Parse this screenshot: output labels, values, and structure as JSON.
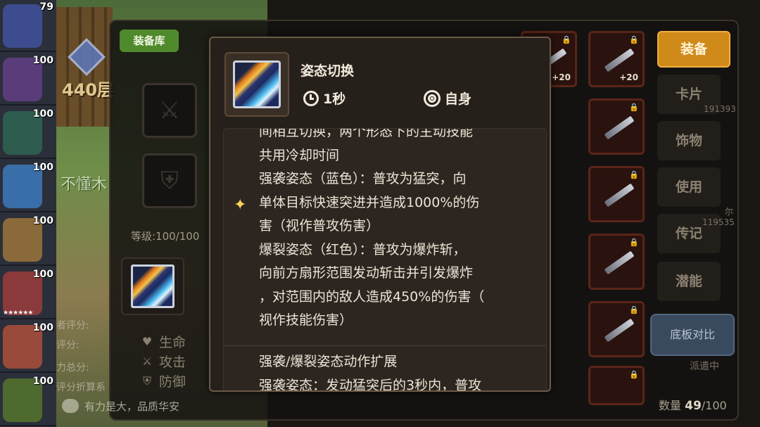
{
  "roster": {
    "levels": [
      "79",
      "100",
      "100",
      "100",
      "100",
      "100",
      "100",
      "100"
    ]
  },
  "background": {
    "library_tab": "装备库",
    "floor": "440层",
    "guild": "不懂木",
    "level": "等级:100/100",
    "chat": "有力是大，品质华安",
    "stats": [
      {
        "icon": "heart-icon",
        "label": "生命"
      },
      {
        "icon": "sword-icon",
        "label": "攻击"
      },
      {
        "icon": "shield-icon",
        "label": "防御"
      }
    ],
    "side_labels": [
      "者评分:",
      "评分:",
      "力总分:",
      "评分折算系"
    ]
  },
  "inventory": {
    "plus_labels": [
      "+20",
      "+20"
    ]
  },
  "menu": {
    "equip": "装备",
    "card": "卡片",
    "accessory": "饰物",
    "use": "使用",
    "biography": "传记",
    "potential": "潜能",
    "compare": "底板对比",
    "power_a": "191393",
    "power_b": "119535",
    "name_b": "尔",
    "dispatch": "派遣中",
    "count_label": "数量",
    "count_value": "49",
    "count_max": "/100"
  },
  "tooltip": {
    "skill_name": "姿态切换",
    "cooldown": "1秒",
    "target": "自身",
    "description": "间相互切换，两个形态下的主动技能\n共用冷却时间\n强袭姿态（蓝色）：普攻为猛突，向\n单体目标快速突进并造成1000%的伤\n害（视作普攻伤害）\n爆裂姿态（红色）：普攻为爆炸斩，\n向前方扇形范围发动斩击并引发爆炸\n，对范围内的敌人造成450%的伤害（\n视作技能伤害）",
    "extension": "强袭/爆裂姿态动作扩展\n强袭姿态：发动猛突后的3秒内，普攻"
  },
  "colors": {
    "equip_button": "#d08a1a",
    "library_tab": "#4f8a2c",
    "sparkle": "#f6d25a",
    "tooltip_bg": "#26201b"
  }
}
